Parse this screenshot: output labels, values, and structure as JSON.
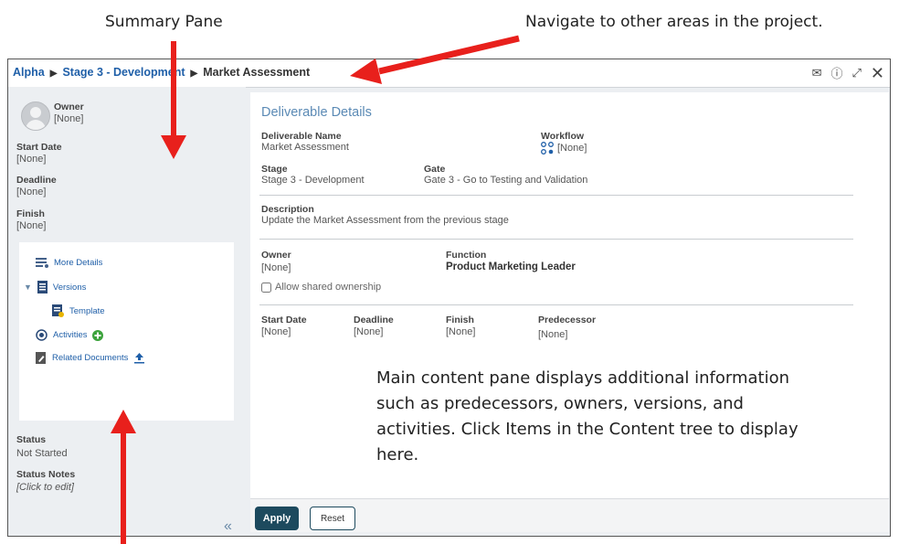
{
  "annotations": {
    "summary_pane": "Summary Pane",
    "navigate": "Navigate to other areas in the project.",
    "main_content": "Main content pane displays additional information such as predecessors, owners, versions, and activities. Click Items in the Content tree to display here."
  },
  "breadcrumb": {
    "item1": "Alpha",
    "item2": "Stage 3 - Development",
    "item3": "Market Assessment",
    "separator": "▶"
  },
  "title_icons": [
    "mail-icon",
    "help-icon",
    "expand-icon",
    "close-icon"
  ],
  "summary": {
    "owner_label": "Owner",
    "owner_value": "[None]",
    "start_label": "Start Date",
    "start_value": "[None]",
    "deadline_label": "Deadline",
    "deadline_value": "[None]",
    "finish_label": "Finish",
    "finish_value": "[None]",
    "status_label": "Status",
    "status_value": "Not Started",
    "notes_label": "Status Notes",
    "notes_value": "[Click to edit]"
  },
  "tree": {
    "more_details": "More Details",
    "versions": "Versions",
    "template": "Template",
    "activities": "Activities",
    "related_documents": "Related Documents"
  },
  "details": {
    "title": "Deliverable Details",
    "deliverable_name_label": "Deliverable Name",
    "deliverable_name_value": "Market Assessment",
    "workflow_label": "Workflow",
    "workflow_value": "[None]",
    "stage_label": "Stage",
    "stage_value": "Stage 3 - Development",
    "gate_label": "Gate",
    "gate_value": "Gate 3 - Go to Testing and Validation",
    "description_label": "Description",
    "description_value": "Update the Market Assessment from the previous stage",
    "owner_label": "Owner",
    "owner_value": "[None]",
    "function_label": "Function",
    "function_value": "Product Marketing Leader",
    "shared_ownership": "Allow shared ownership",
    "start_label": "Start Date",
    "start_value": "[None]",
    "deadline_label": "Deadline",
    "deadline_value": "[None]",
    "finish_label": "Finish",
    "finish_value": "[None]",
    "predecessor_label": "Predecessor",
    "predecessor_value": "[None]"
  },
  "buttons": {
    "apply": "Apply",
    "reset": "Reset"
  },
  "colors": {
    "arrow": "#e8201c",
    "link": "#1f5fa8",
    "apply_bg": "#1d4a5e",
    "title_blue": "#5b8ab5"
  }
}
